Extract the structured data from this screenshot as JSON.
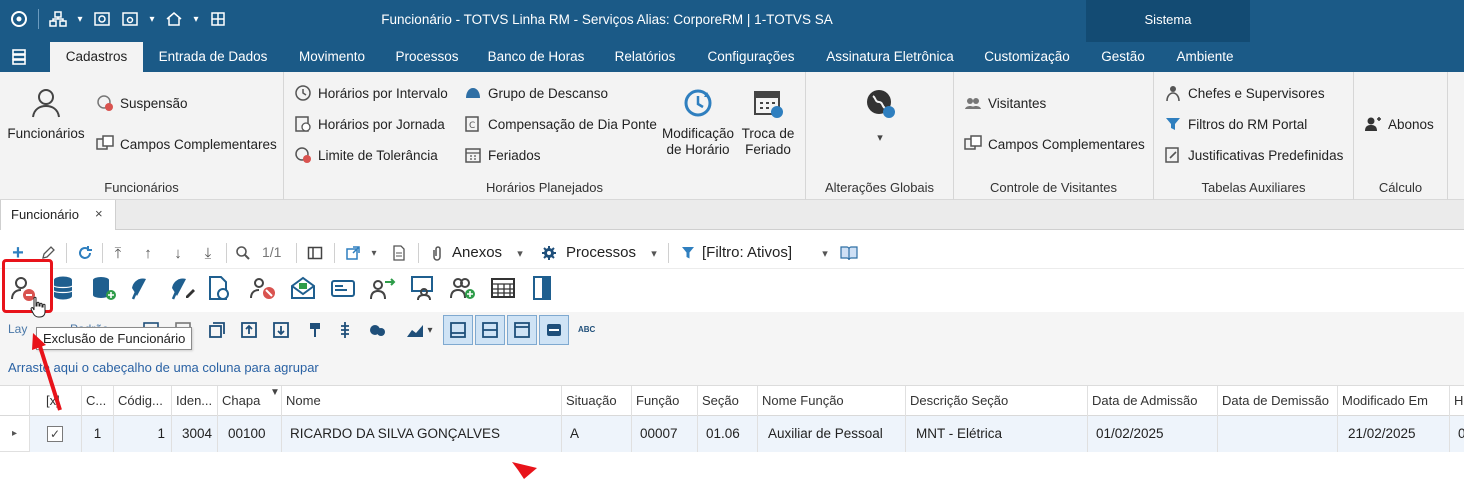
{
  "window": {
    "title": "Funcionário - TOTVS Linha RM - Serviços  Alias: CorporeRM | 1-TOTVS SA",
    "sistema_label": "Sistema"
  },
  "menu": {
    "tabs": [
      "Cadastros",
      "Entrada de Dados",
      "Movimento",
      "Processos",
      "Banco de Horas",
      "Relatórios",
      "Configurações",
      "Assinatura Eletrônica",
      "Customização",
      "Gestão",
      "Ambiente"
    ],
    "active": "Cadastros"
  },
  "ribbon": {
    "funcionarios": {
      "big_label": "Funcionários",
      "items": [
        "Suspensão",
        "Campos Complementares"
      ],
      "group_label": "Funcionários"
    },
    "horarios": {
      "items": [
        "Horários por Intervalo",
        "Horários por Jornada",
        "Limite de Tolerância",
        "Grupo de Descanso",
        "Compensação de Dia Ponte",
        "Feriados"
      ],
      "modificacao": "Modificação de Horário",
      "troca": "Troca de Feriado",
      "group_label": "Horários Planejados"
    },
    "alteracoes": {
      "group_label": "Alterações Globais"
    },
    "visitantes": {
      "items": [
        "Visitantes",
        "Campos Complementares"
      ],
      "group_label": "Controle de Visitantes"
    },
    "tabelas": {
      "items": [
        "Chefes e Supervisores",
        "Filtros do RM Portal",
        "Justificativas Predefinidas"
      ],
      "group_label": "Tabelas Auxiliares"
    },
    "calculo": {
      "items": [
        "Abonos"
      ],
      "group_label": "Cálculo"
    }
  },
  "document_tab": {
    "label": "Funcionário",
    "close": "×"
  },
  "toolbar": {
    "pagination": "1/1",
    "anexos": "Anexos",
    "processos": "Processos",
    "filtro": "[Filtro: Ativos]"
  },
  "tooltip": "Exclusão de Funcionário",
  "toolbar3": {
    "layout_partial": "Lay",
    "padrao_partial": "Padrão",
    "abc": "ABC"
  },
  "group_panel": "Arraste aqui o cabeçalho de uma coluna para agrupar",
  "grid": {
    "columns": [
      "[x]",
      "C...",
      "Códig...",
      "Iden...",
      "Chapa",
      "Nome",
      "Situação",
      "Função",
      "Seção",
      "Nome Função",
      "Descrição Seção",
      "Data de Admissão",
      "Data de Demissão",
      "Modificado Em",
      "H"
    ],
    "rows": [
      {
        "checked": "✓",
        "c": "1",
        "codigo": "1",
        "iden": "3004",
        "chapa": "00100",
        "nome": "RICARDO DA SILVA GONÇALVES",
        "situacao": "A",
        "funcao": "00007",
        "secao": "01.06",
        "nome_funcao": "Auxiliar de Pessoal",
        "descricao_secao": "MNT - Elétrica",
        "admissao": "01/02/2025",
        "demissao": "",
        "modificado": "21/02/2025",
        "h": "0"
      }
    ]
  },
  "colors": {
    "titlebar": "#1b5a87",
    "highlight": "#e8131a",
    "link": "#2a62a4"
  }
}
